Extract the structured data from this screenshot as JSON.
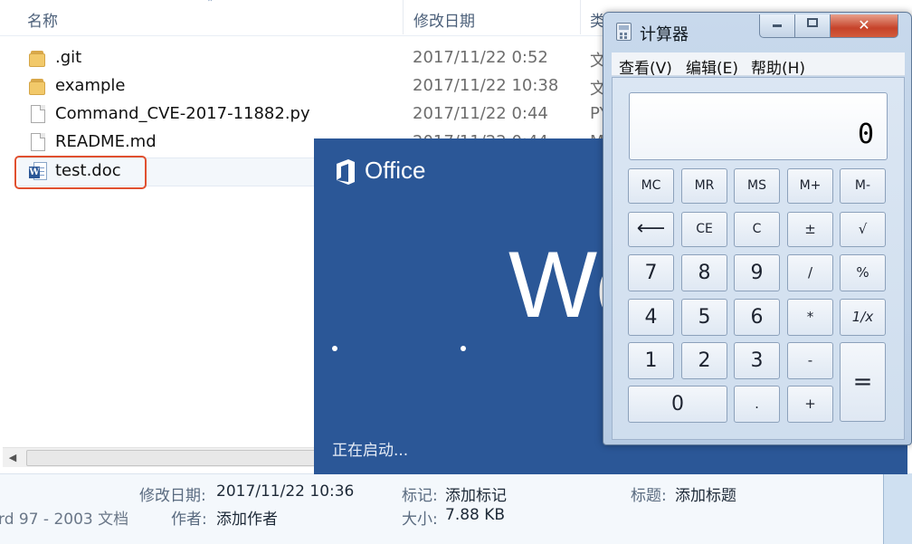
{
  "explorer": {
    "columns": {
      "name": "名称",
      "date": "修改日期",
      "type": "类"
    },
    "files": [
      {
        "name": ".git",
        "date": "2017/11/22 0:52",
        "type": "文",
        "icon": "folder-icon"
      },
      {
        "name": "example",
        "date": "2017/11/22 10:38",
        "type": "文",
        "icon": "folder-icon"
      },
      {
        "name": "Command_CVE-2017-11882.py",
        "date": "2017/11/22 0:44",
        "type": "PY",
        "icon": "python-file-icon"
      },
      {
        "name": "README.md",
        "date": "2017/11/22 0:44",
        "type": "M",
        "icon": "document-icon"
      },
      {
        "name": "test.doc",
        "date": "",
        "type": "",
        "icon": "word-document-icon"
      }
    ],
    "details": {
      "modified_label": "修改日期:",
      "modified_value": "2017/11/22 10:36",
      "tags_label": "标记:",
      "tags_value": "添加标记",
      "title_label": "标题:",
      "title_value": "添加标题",
      "filetype_value": "rd 97 - 2003 文档",
      "author_label": "作者:",
      "author_value": "添加作者",
      "size_label": "大小:",
      "size_value": "7.88 KB"
    }
  },
  "splash": {
    "brand": "Office",
    "app_name": "Wo",
    "status": "正在启动...",
    "bg_color": "#2b5797"
  },
  "calculator": {
    "title": "计算器",
    "menu": [
      "查看(V)",
      "编辑(E)",
      "帮助(H)"
    ],
    "display": "0",
    "window_buttons": {
      "close": "✕"
    },
    "keys": {
      "mc": "MC",
      "mr": "MR",
      "ms": "MS",
      "mplus": "M+",
      "mminus": "M-",
      "back": "⟵",
      "ce": "CE",
      "c": "C",
      "sign": "±",
      "sqrt": "√",
      "k7": "7",
      "k8": "8",
      "k9": "9",
      "div": "/",
      "pct": "%",
      "k4": "4",
      "k5": "5",
      "k6": "6",
      "mul": "*",
      "recip": "1/x",
      "k1": "1",
      "k2": "2",
      "k3": "3",
      "sub": "-",
      "eq": "=",
      "k0": "0",
      "dot": ".",
      "add": "+"
    }
  }
}
